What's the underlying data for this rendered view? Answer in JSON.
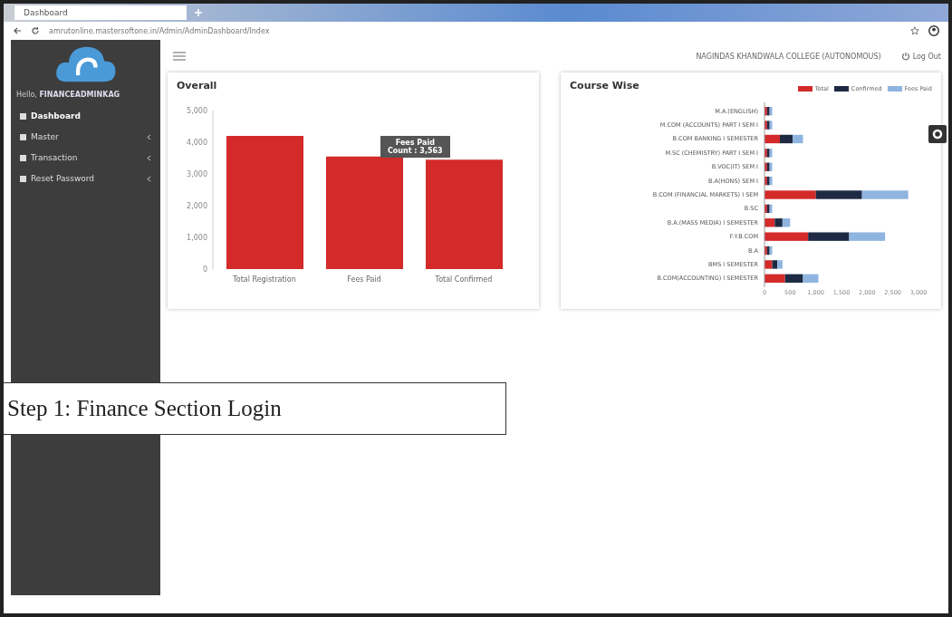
{
  "browser": {
    "tab_title": "Dashboard",
    "url": "amrutonline.mastersoftone.in/Admin/AdminDashboard/Index"
  },
  "sidebar": {
    "greeting": "Hello,",
    "user": "FINANCEADMINKAG",
    "items": [
      {
        "label": "Dashboard",
        "selected": true,
        "has_submenu": false
      },
      {
        "label": "Master",
        "selected": false,
        "has_submenu": true
      },
      {
        "label": "Transaction",
        "selected": false,
        "has_submenu": true
      },
      {
        "label": "Reset Password",
        "selected": false,
        "has_submenu": true
      }
    ]
  },
  "header": {
    "college": "NAGINDAS KHANDWALA COLLEGE (AUTONOMOUS)",
    "logout": "Log Out"
  },
  "overall": {
    "title": "Overall",
    "tooltip": {
      "title": "Fees Paid",
      "value": ": 3,563"
    },
    "chart_data": {
      "type": "bar",
      "categories": [
        "Total Registration",
        "Fees Paid",
        "Total Confirmed"
      ],
      "series": [
        {
          "name": "Count",
          "color": "#d42a2a",
          "values": [
            4200,
            3550,
            3450
          ]
        }
      ],
      "ylim": [
        0,
        5000
      ],
      "yticks": [
        0,
        {
          "value": 1000,
          "label": "1,000"
        },
        {
          "value": 2000,
          "label": "2,000"
        },
        {
          "value": 3000,
          "label": "3,000"
        },
        {
          "value": 4000,
          "label": "4,000"
        },
        {
          "value": 5000,
          "label": "5,000"
        }
      ]
    }
  },
  "course": {
    "title": "Course Wise",
    "chart_data": {
      "type": "bar",
      "orientation": "horizontal",
      "stacked": true,
      "categories": [
        "M.A.(ENGLISH)",
        "M.COM (ACCOUNTS) PART I SEM I",
        "B.COM BANKING I SEMESTER",
        "M.SC (CHEMISTRY) PART I SEM I",
        "B.VOC(IT) SEM I",
        "B.A(HONS) SEM I",
        "B.COM (FINANCIAL MARKETS) I SEM",
        "B.SC",
        "B.A.(MASS MEDIA) I SEMESTER",
        "F.Y.B.COM",
        "B.A",
        "BMS I SEMESTER",
        "B.COM(ACCOUNTING) I SEMESTER"
      ],
      "series": [
        {
          "name": "Total",
          "color": "#d42a2a",
          "values": [
            50,
            50,
            300,
            50,
            50,
            50,
            1000,
            50,
            200,
            850,
            50,
            150,
            400
          ]
        },
        {
          "name": "Confirmed",
          "color": "#1e2a44",
          "values": [
            50,
            50,
            250,
            50,
            50,
            50,
            900,
            50,
            150,
            800,
            50,
            100,
            350
          ]
        },
        {
          "name": "Fees Paid",
          "color": "#8fb4e0",
          "values": [
            50,
            50,
            200,
            50,
            50,
            50,
            900,
            50,
            150,
            700,
            50,
            100,
            300
          ]
        }
      ],
      "xlim": [
        0,
        3000
      ],
      "xticks": [
        0,
        500,
        {
          "value": 1000,
          "label": "1,000"
        },
        {
          "value": 1500,
          "label": "1,500"
        },
        {
          "value": 2000,
          "label": "2,000"
        },
        {
          "value": 2500,
          "label": "2,500"
        },
        {
          "value": 3000,
          "label": "3,000"
        }
      ]
    }
  },
  "caption": "Step 1: Finance Section Login"
}
